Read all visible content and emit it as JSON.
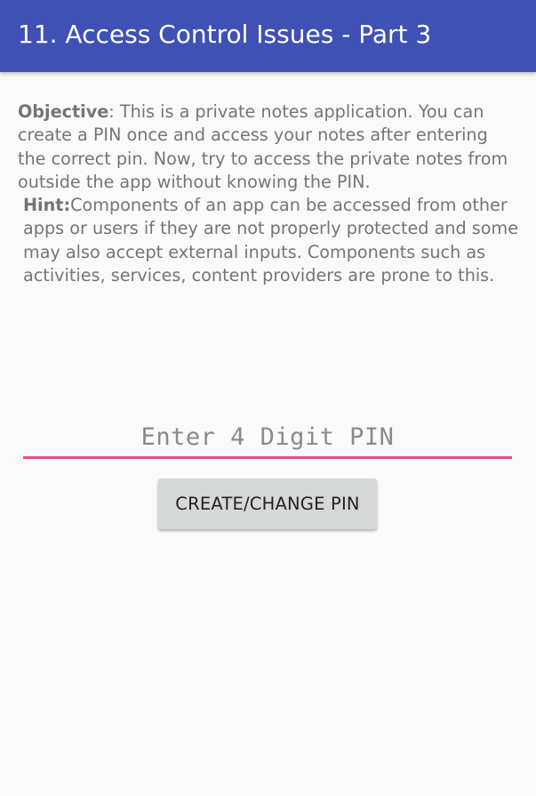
{
  "app_bar": {
    "title": "11. Access Control Issues - Part 3",
    "color": "#3f51b5"
  },
  "description": {
    "objective_label": "Objective",
    "objective_text": ": This is a private notes application. You can create a PIN once and access your notes after entering the correct pin. Now, try to access the private notes from outside the app without knowing the PIN.",
    "hint_label": "Hint:",
    "hint_text": "Components of an app can be accessed from other apps or users if they are not properly protected and some may also accept external inputs. Components such as activities, services, content providers are prone to this."
  },
  "pin_field": {
    "placeholder": "Enter 4 Digit PIN",
    "value": "",
    "underline_color": "#ee4a87"
  },
  "create_button": {
    "label": "CREATE/CHANGE PIN"
  }
}
